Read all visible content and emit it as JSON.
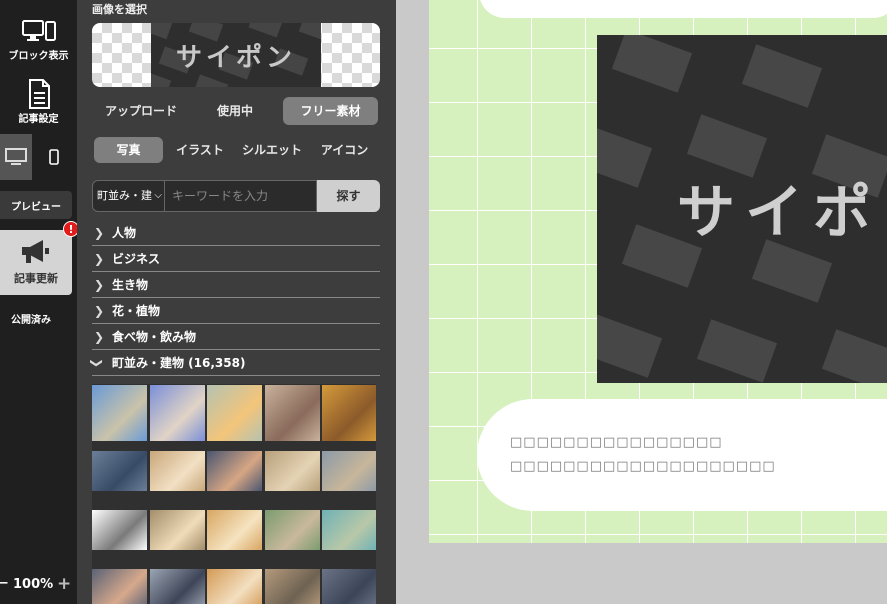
{
  "rail": {
    "block_view": "ブロック表示",
    "article_settings": "記事設定",
    "preview": "プレビュー",
    "update": "記事更新",
    "update_badge": "!",
    "status": "公開済み",
    "zoom": "100%",
    "zoom_minus": "−",
    "zoom_plus": "+"
  },
  "panel": {
    "title": "画像を選択",
    "preview_logo": "サイポン",
    "source_tabs": [
      "アップロード",
      "使用中",
      "フリー素材"
    ],
    "source_active": "フリー素材",
    "type_tabs": [
      "写真",
      "イラスト",
      "シルエット",
      "アイコン"
    ],
    "type_active": "写真",
    "search": {
      "category_value": "町並み・建",
      "placeholder": "キーワードを入力",
      "button": "探す"
    },
    "categories": [
      {
        "label": "人物",
        "open": false
      },
      {
        "label": "ビジネス",
        "open": false
      },
      {
        "label": "生き物",
        "open": false
      },
      {
        "label": "花・植物",
        "open": false
      },
      {
        "label": "食べ物・飲み物",
        "open": false
      },
      {
        "label": "町並み・建物 (16,358)",
        "open": true
      }
    ]
  },
  "canvas": {
    "hero_logo": "サイポ",
    "text_line_1": "□□□□□□□□□□□□□□□□",
    "text_line_2": "□□□□□□□□□□□□□□□□□□□□"
  },
  "colors": {
    "rail_bg": "#1f1f1f",
    "panel_bg": "#3d3d3d",
    "active_tab": "#7f7f7f",
    "page_green": "#d6f0be",
    "badge_red": "#e21b1b"
  },
  "thumbs": [
    [
      "#6a9ad6",
      "#c9c3a9"
    ],
    [
      "#7a8fd8",
      "#e1d4c6"
    ],
    [
      "#b5c2b1",
      "#f3c57a"
    ],
    [
      "#c9b29c",
      "#8a6a5b"
    ],
    [
      "#d69b3b",
      "#8b5a2a"
    ],
    [
      "#6b7f99",
      "#384b66"
    ],
    [
      "#c8a77a",
      "#f2e0c4"
    ],
    [
      "#4a5670",
      "#d6a684"
    ],
    [
      "#b8a07a",
      "#e4d3b5"
    ],
    [
      "#8c9aa8",
      "#c7b69a"
    ],
    [
      "#ffffff",
      "#7a7a7a"
    ],
    [
      "#a38d6a",
      "#f0dcb8"
    ],
    [
      "#d8a662",
      "#f5e3c0"
    ],
    [
      "#7b9c6e",
      "#c9b89c"
    ],
    [
      "#6fb1b6",
      "#b8c8a8"
    ],
    [
      "#5a6275",
      "#d7a98c"
    ],
    [
      "#9ba5b3",
      "#3f4558"
    ],
    [
      "#d39a56",
      "#f3dfc0"
    ],
    [
      "#b59a7c",
      "#6e6252"
    ],
    [
      "#6b7386",
      "#3c4458"
    ]
  ]
}
